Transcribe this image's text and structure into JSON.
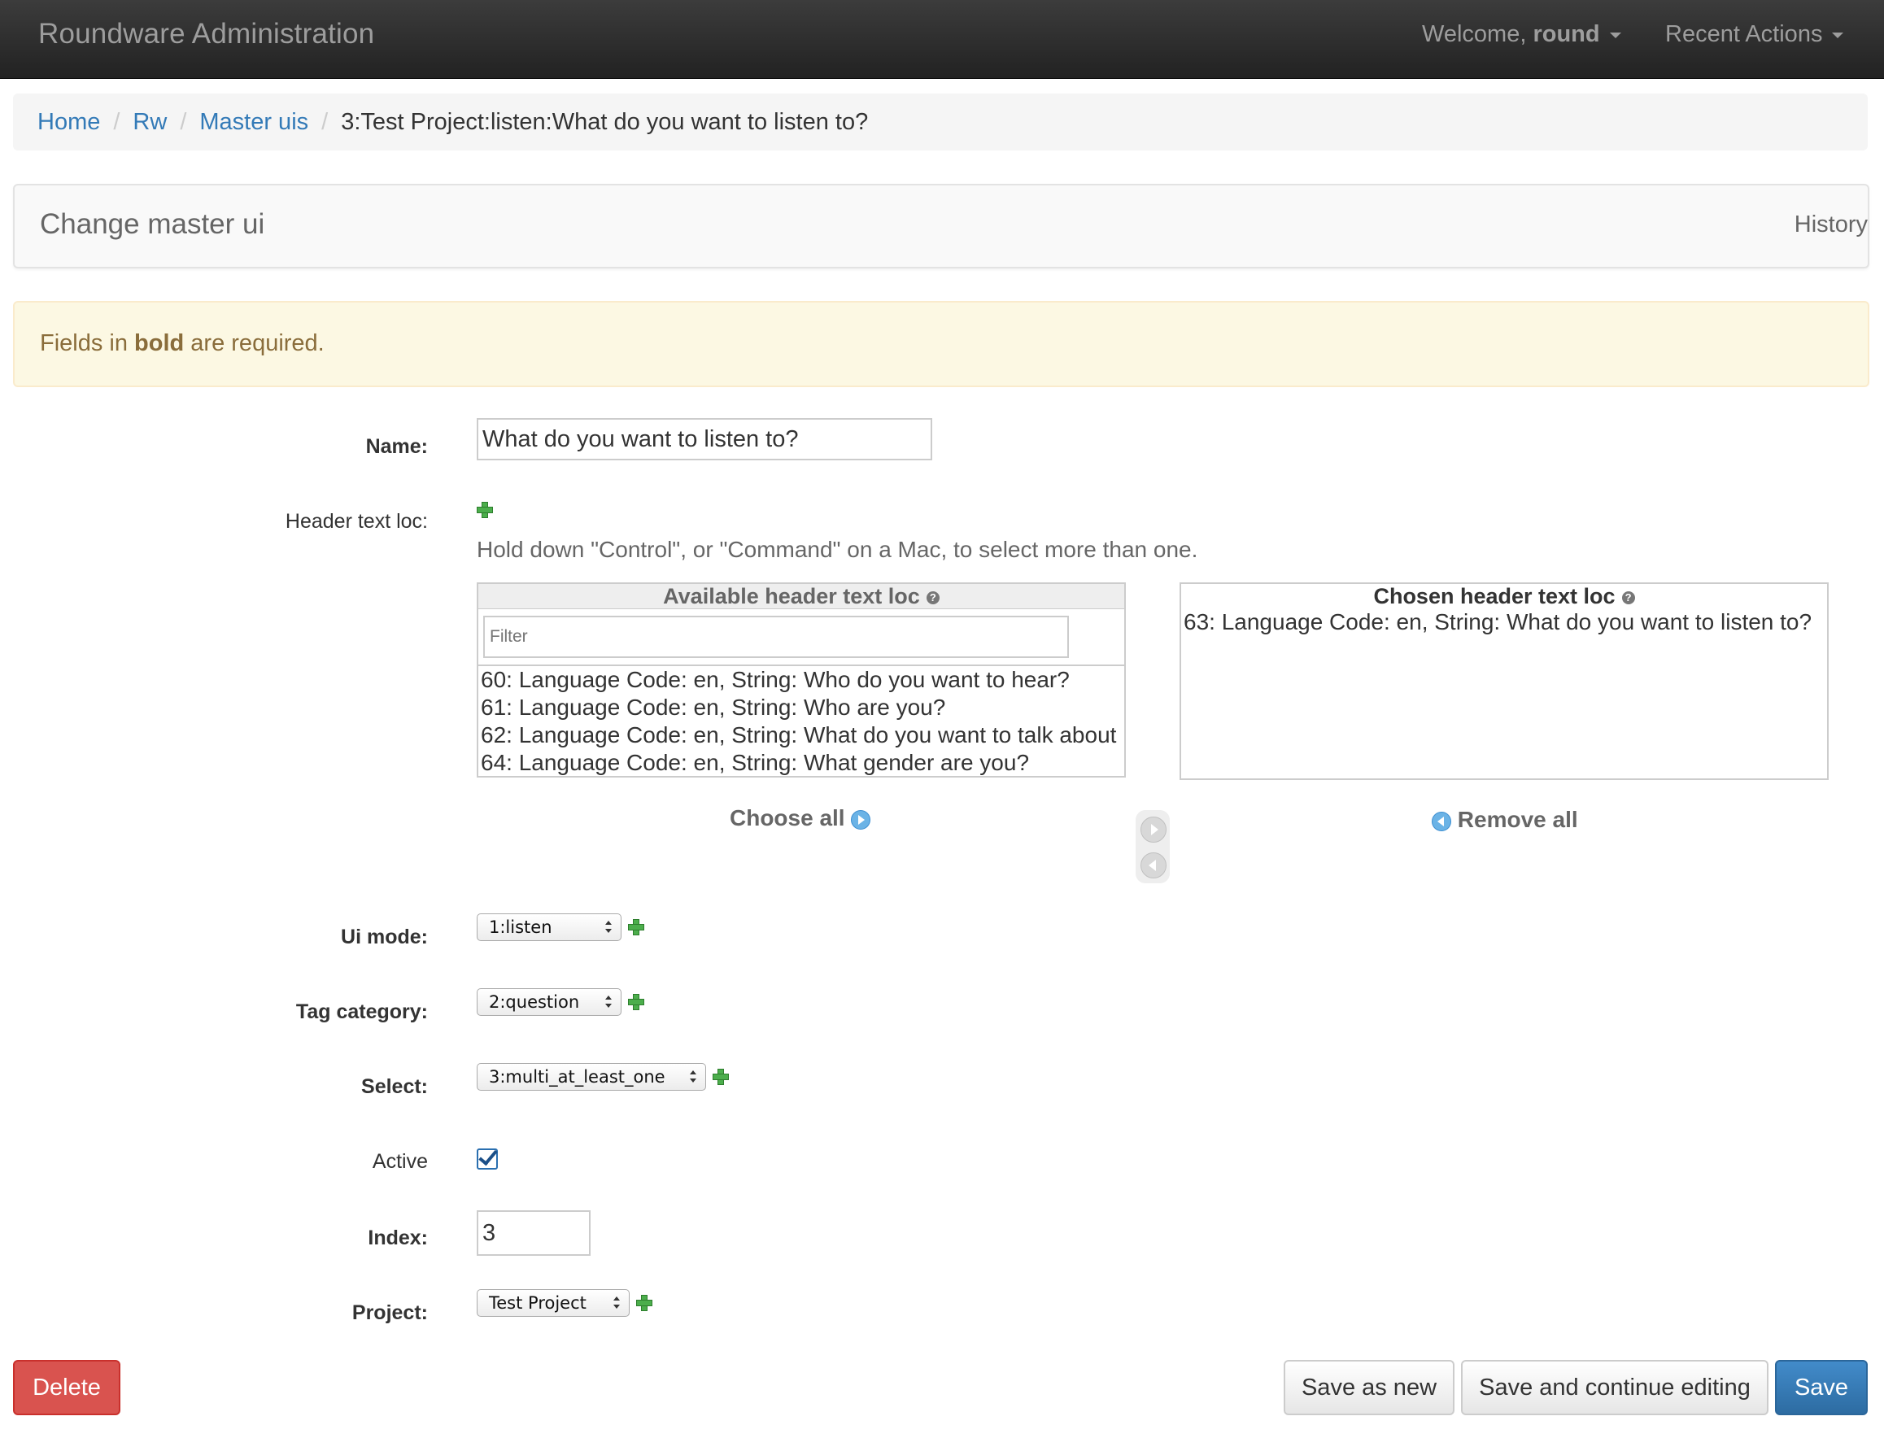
{
  "navbar": {
    "brand": "Roundware Administration",
    "welcome_prefix": "Welcome, ",
    "welcome_user": "round",
    "recent_actions": "Recent Actions"
  },
  "breadcrumb": {
    "home": "Home",
    "app": "Rw",
    "model": "Master uis",
    "current": "3:Test Project:listen:What do you want to listen to?",
    "separator": "/"
  },
  "panel": {
    "title": "Change master ui",
    "history": "History"
  },
  "alert": {
    "prefix": "Fields in ",
    "bold": "bold",
    "suffix": " are required."
  },
  "form": {
    "name": {
      "label": "Name:",
      "value": "What do you want to listen to?"
    },
    "header_text_loc": {
      "label": "Header text loc:",
      "help": "Hold down \"Control\", or \"Command\" on a Mac, to select more than one.",
      "available_title": "Available header text loc",
      "chosen_title": "Chosen header text loc",
      "filter_placeholder": "Filter",
      "available_options": [
        "60: Language Code: en, String: Who do you want to hear?",
        "61: Language Code: en, String: Who are you?",
        "62: Language Code: en, String: What do you want to talk about",
        "64: Language Code: en, String: What gender are you?"
      ],
      "chosen_options": [
        "63: Language Code: en, String: What do you want to listen to?"
      ],
      "choose_all": "Choose all",
      "remove_all": "Remove all"
    },
    "ui_mode": {
      "label": "Ui mode:",
      "value": "1:listen"
    },
    "tag_category": {
      "label": "Tag category:",
      "value": "2:question"
    },
    "select": {
      "label": "Select:",
      "value": "3:multi_at_least_one"
    },
    "active": {
      "label": "Active",
      "checked": true
    },
    "index": {
      "label": "Index:",
      "value": "3"
    },
    "project": {
      "label": "Project:",
      "value": "Test Project"
    }
  },
  "buttons": {
    "delete": "Delete",
    "save_as_new": "Save as new",
    "save_continue": "Save and continue editing",
    "save": "Save"
  },
  "colors": {
    "navbar_bg": "#222222",
    "link": "#337ab7",
    "alert_bg": "#fcf8e3",
    "danger": "#d9534f",
    "primary": "#337ab7",
    "add_green": "#4cae4c"
  },
  "icons": {
    "add": "plus-icon",
    "help": "question-circle-icon",
    "choose_all": "circle-arrow-right-icon",
    "remove_all": "circle-arrow-left-icon",
    "dropdown": "caret-down-icon"
  }
}
